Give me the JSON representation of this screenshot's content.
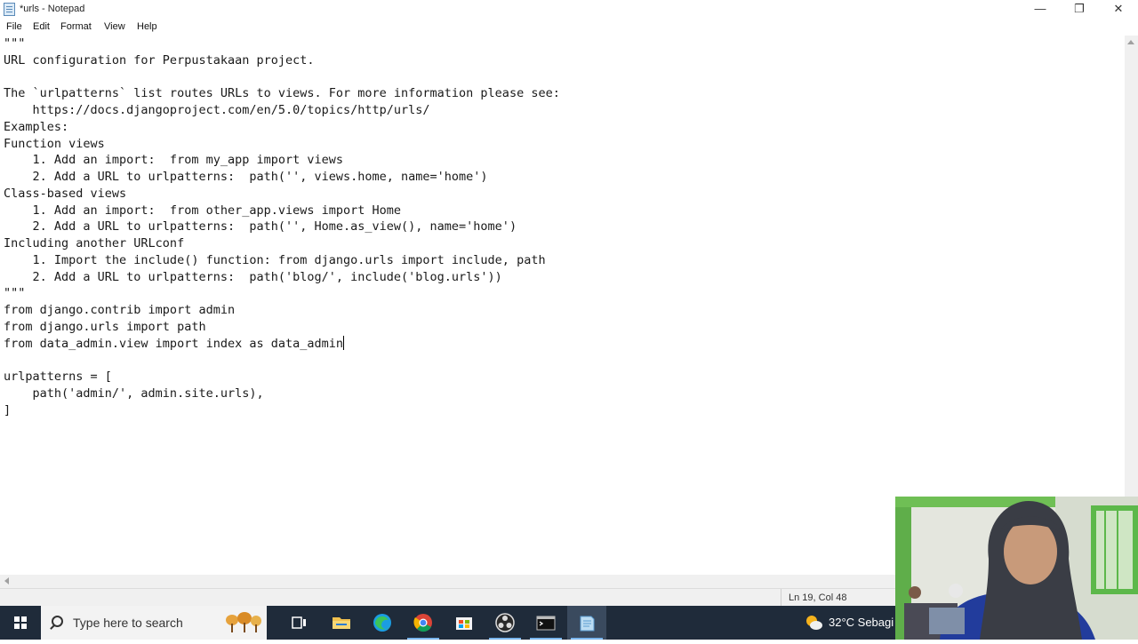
{
  "window": {
    "title": "*urls - Notepad",
    "minimize_glyph": "—",
    "restore_glyph": "❐",
    "close_glyph": "✕"
  },
  "menu": {
    "file": "File",
    "edit": "Edit",
    "format": "Format",
    "view": "View",
    "help": "Help"
  },
  "editor": {
    "lines": [
      "\"\"\"",
      "URL configuration for Perpustakaan project.",
      "",
      "The `urlpatterns` list routes URLs to views. For more information please see:",
      "    https://docs.djangoproject.com/en/5.0/topics/http/urls/",
      "Examples:",
      "Function views",
      "    1. Add an import:  from my_app import views",
      "    2. Add a URL to urlpatterns:  path('', views.home, name='home')",
      "Class-based views",
      "    1. Add an import:  from other_app.views import Home",
      "    2. Add a URL to urlpatterns:  path('', Home.as_view(), name='home')",
      "Including another URLconf",
      "    1. Import the include() function: from django.urls import include, path",
      "    2. Add a URL to urlpatterns:  path('blog/', include('blog.urls'))",
      "\"\"\"",
      "from django.contrib import admin",
      "from django.urls import path",
      "from data_admin.view import index as data_admin",
      "",
      "urlpatterns = [",
      "    path('admin/', admin.site.urls),",
      "]"
    ],
    "caret_line": 19,
    "caret_col": 48
  },
  "statusbar": {
    "position": "Ln 19, Col 48"
  },
  "taskbar": {
    "search_placeholder": "Type here to search",
    "weather_text": "32°C  Sebagi",
    "icons": [
      "windows-start-icon",
      "task-view-icon",
      "file-explorer-icon",
      "edge-icon",
      "chrome-icon",
      "store-icon",
      "obs-icon",
      "terminal-icon",
      "notepad-icon"
    ]
  },
  "colors": {
    "taskbar": "#1f2b3a",
    "accent_underline": "#7ab6ee",
    "statusbar": "#f0f0f0"
  }
}
